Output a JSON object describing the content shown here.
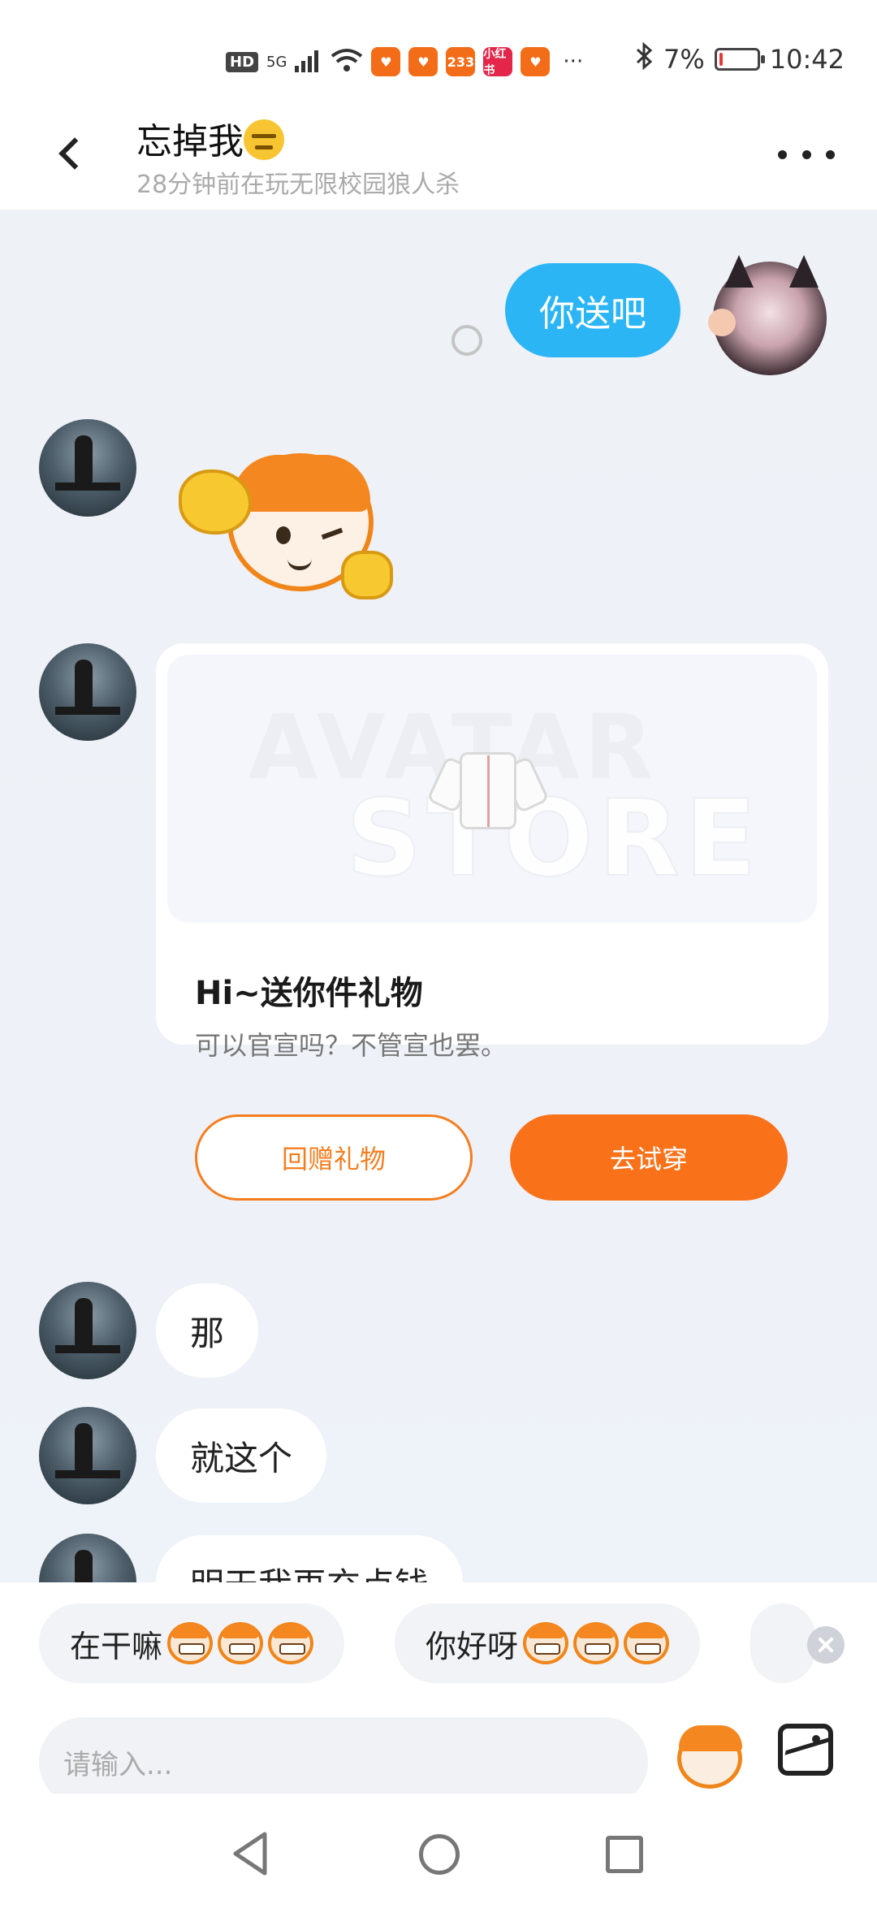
{
  "status_bar": {
    "hd": "HD",
    "network": "5G",
    "app_icons": [
      "app-icon",
      "app-icon",
      "233",
      "小红书",
      "app-icon"
    ],
    "more": "···",
    "battery": "7%",
    "battery_level": 0.07,
    "time": "10:42"
  },
  "header": {
    "name": "忘掉我",
    "status": "28分钟前在玩无限校园狼人杀"
  },
  "messages": {
    "mine_1": "你送吧",
    "gift_card": {
      "watermark_top": "AVATAR",
      "watermark_bottom": "STORE",
      "title": "Hi~送你件礼物",
      "description": "可以官宣吗？不管宣也罢。",
      "return_button": "回赠礼物",
      "try_button": "去试穿"
    },
    "other_1": "那",
    "other_2": "就这个",
    "other_3": "明天我再充点钱"
  },
  "quick_replies": [
    {
      "label": "在干嘛"
    },
    {
      "label": "你好呀"
    }
  ],
  "input": {
    "placeholder": "请输入..."
  },
  "colors": {
    "accent_blue": "#2bb5f5",
    "accent_orange": "#f9721a"
  }
}
